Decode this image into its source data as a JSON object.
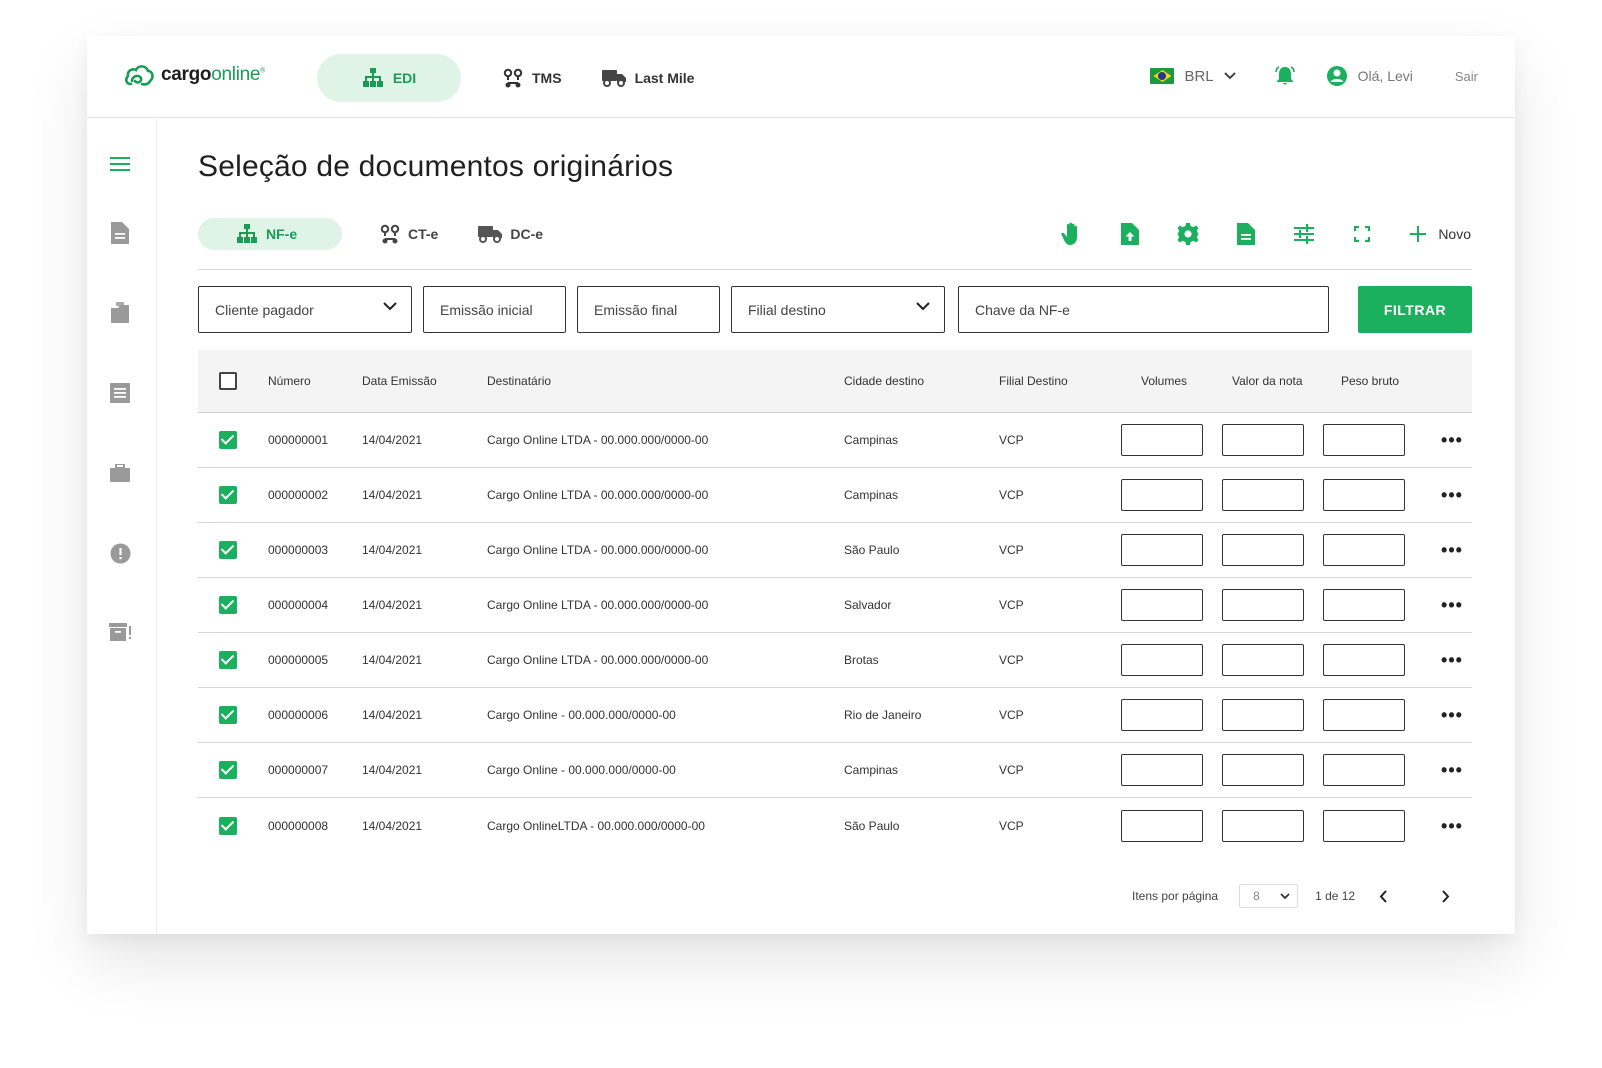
{
  "brand": {
    "name_a": "cargo",
    "name_b": "online",
    "mark": "®"
  },
  "topnav": [
    {
      "label": "EDI",
      "active": true,
      "icon": "sitemap-icon"
    },
    {
      "label": "TMS",
      "active": false,
      "icon": "route-icon"
    },
    {
      "label": "Last Mile",
      "active": false,
      "icon": "truck-icon"
    }
  ],
  "topright": {
    "currency": "BRL",
    "greeting": "Olá, Levi",
    "logout": "Sair"
  },
  "sidebar": [
    "menu-icon",
    "document-icon",
    "files-icon",
    "list-icon",
    "briefcase-icon",
    "alert-icon",
    "archive-alert-icon"
  ],
  "page": {
    "title": "Seleção de documentos originários"
  },
  "doc_tabs": [
    {
      "label": "NF-e",
      "active": true
    },
    {
      "label": "CT-e",
      "active": false
    },
    {
      "label": "DC-e",
      "active": false
    }
  ],
  "toolbar": {
    "icons": [
      "hand-icon",
      "file-upload-icon",
      "gear-icon",
      "file-text-icon",
      "sliders-icon",
      "fullscreen-icon"
    ],
    "new_label": "Novo"
  },
  "filters": {
    "cliente_pagador": "Cliente pagador",
    "emissao_inicial": "Emissão inicial",
    "emissao_final": "Emissão final",
    "filial_destino": "Filial destino",
    "chave_nfe": "Chave da NF-e",
    "filter_button": "FILTRAR"
  },
  "table": {
    "headers": {
      "numero": "Número",
      "data_emissao": "Data Emissão",
      "destinatario": "Destinatário",
      "cidade_destino": "Cidade destino",
      "filial_destino": "Filial Destino",
      "volumes": "Volumes",
      "valor_nota": "Valor da nota",
      "peso_bruto": "Peso bruto"
    },
    "rows": [
      {
        "numero": "000000001",
        "data": "14/04/2021",
        "destinatario": "Cargo Online  LTDA - 00.000.000/0000-00",
        "cidade": "Campinas",
        "filial": "VCP",
        "checked": true
      },
      {
        "numero": "000000002",
        "data": "14/04/2021",
        "destinatario": "Cargo Online LTDA - 00.000.000/0000-00",
        "cidade": "Campinas",
        "filial": "VCP",
        "checked": true
      },
      {
        "numero": "000000003",
        "data": "14/04/2021",
        "destinatario": "Cargo Online LTDA - 00.000.000/0000-00",
        "cidade": "São Paulo",
        "filial": "VCP",
        "checked": true
      },
      {
        "numero": "000000004",
        "data": "14/04/2021",
        "destinatario": "Cargo Online LTDA - 00.000.000/0000-00",
        "cidade": "Salvador",
        "filial": "VCP",
        "checked": true
      },
      {
        "numero": "000000005",
        "data": "14/04/2021",
        "destinatario": "Cargo Online LTDA - 00.000.000/0000-00",
        "cidade": "Brotas",
        "filial": "VCP",
        "checked": true
      },
      {
        "numero": "000000006",
        "data": "14/04/2021",
        "destinatario": "Cargo Online - 00.000.000/0000-00",
        "cidade": "Rio de Janeiro",
        "filial": "VCP",
        "checked": true
      },
      {
        "numero": "000000007",
        "data": "14/04/2021",
        "destinatario": "Cargo Online - 00.000.000/0000-00",
        "cidade": "Campinas",
        "filial": "VCP",
        "checked": true
      },
      {
        "numero": "000000008",
        "data": "14/04/2021",
        "destinatario": "Cargo OnlineLTDA - 00.000.000/0000-00",
        "cidade": "São Paulo",
        "filial": "VCP",
        "checked": true
      }
    ]
  },
  "pagination": {
    "label": "Itens por página",
    "per_page": "8",
    "range": "1 de 12"
  },
  "colors": {
    "accent": "#1ab05e",
    "accent_soft": "#dff3e7",
    "text": "#222222"
  }
}
